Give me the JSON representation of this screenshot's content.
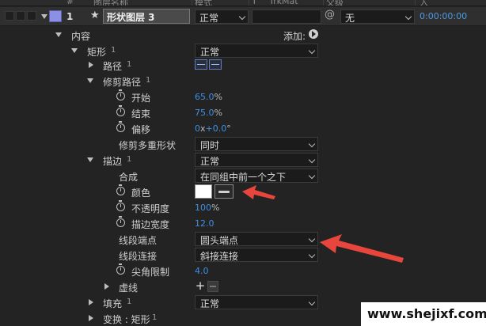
{
  "header": {
    "columns": [
      "#",
      "图层名称",
      "模式",
      "T",
      "TrkMat",
      "父级",
      "入"
    ]
  },
  "layer": {
    "number": "1",
    "name": "形状图层 3",
    "mode": "正常",
    "parent": "无",
    "time": "0:00:00:00",
    "label_color": "#8c8fe6"
  },
  "rows": {
    "content": {
      "label": "内容",
      "add_label": "添加:"
    },
    "rect": {
      "label": "矩形",
      "num": "1",
      "mode": "正常"
    },
    "path": {
      "label": "路径",
      "num": "1"
    },
    "trim": {
      "label": "修剪路径",
      "num": "1"
    },
    "start": {
      "label": "开始",
      "value": "65.0",
      "unit": "%"
    },
    "end": {
      "label": "结束",
      "value": "75.0",
      "unit": "%"
    },
    "offset": {
      "label": "偏移",
      "value_a": "0",
      "mid": "x",
      "value_b": "+0.0",
      "unit": "°"
    },
    "trim_multi": {
      "label": "修剪多重形状",
      "value": "同时"
    },
    "stroke": {
      "label": "描边",
      "num": "1",
      "mode": "正常"
    },
    "composite": {
      "label": "合成",
      "value": "在同组中前一个之下"
    },
    "color": {
      "label": "颜色",
      "swatch": "#ffffff"
    },
    "opacity": {
      "label": "不透明度",
      "value": "100",
      "unit": "%"
    },
    "stroke_width": {
      "label": "描边宽度",
      "value": "12.0"
    },
    "line_cap": {
      "label": "线段端点",
      "value": "圆头端点"
    },
    "line_join": {
      "label": "线段连接",
      "value": "斜接连接"
    },
    "miter": {
      "label": "尖角限制",
      "value": "4.0"
    },
    "dashes": {
      "label": "虚线"
    },
    "fill": {
      "label": "填充",
      "num": "1",
      "mode": "正常"
    },
    "transform": {
      "label": "变换 : 矩形",
      "num": "1"
    }
  },
  "watermark": {
    "text": "www.shejixf.com"
  },
  "colors": {
    "accent_value": "#3f8fdf",
    "arrow": "#e8453c"
  }
}
